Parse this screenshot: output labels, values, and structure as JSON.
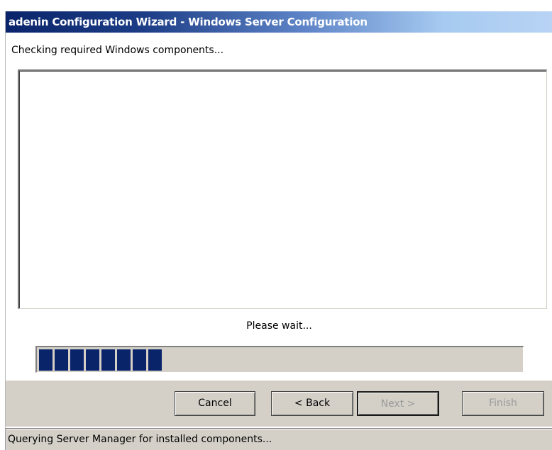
{
  "window": {
    "title": "adenin Configuration Wizard - Windows Server Configuration"
  },
  "main": {
    "heading": "Checking required Windows components...",
    "log_text": "",
    "wait_message": "Please wait...",
    "progress": {
      "segments_filled": 8,
      "label": ""
    }
  },
  "buttons": {
    "cancel": "Cancel",
    "back": "< Back",
    "next": "Next >",
    "finish": "Finish"
  },
  "status": {
    "text": "Querying Server Manager for installed components..."
  },
  "colors": {
    "title_gradient_start": "#0a246a",
    "title_gradient_end": "#b8d3f4",
    "progress_fill": "#0a246a",
    "panel": "#d4d0c8"
  }
}
